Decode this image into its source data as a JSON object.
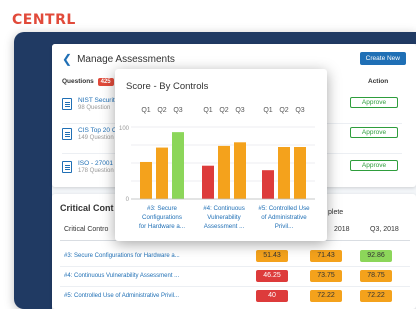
{
  "brand": "CENTRL",
  "assessments": {
    "title": "Manage Assessments",
    "create_button": "Create New",
    "questions_label": "Questions",
    "questions_count": "425",
    "d_label": "D",
    "action_label": "Action",
    "rows": [
      {
        "title": "NIST Security",
        "sub": "98 Question",
        "action": "Approve"
      },
      {
        "title": "CIS Top 20 C",
        "sub": "149 Question",
        "action": "Approve"
      },
      {
        "title": "ISO - 27001 -",
        "sub": "178 Question",
        "action": "Approve"
      }
    ]
  },
  "critical": {
    "title": "Critical Cont",
    "complete_label": "plete",
    "col_name": "Critical Contro",
    "col_2018": "2018",
    "col_q3": "Q3, 2018",
    "rows": [
      {
        "name": "#3: Secure Configurations for Hardware a...",
        "v1": "51.43",
        "v2": "71.43",
        "v3": "92.86",
        "c1": "orange",
        "c2": "orange",
        "c3": "green"
      },
      {
        "name": "#4: Continuous Vulnerability Assessment ...",
        "v1": "46.25",
        "v2": "73.75",
        "v3": "78.75",
        "c1": "red",
        "c2": "orange",
        "c3": "orange"
      },
      {
        "name": "#5: Controlled Use of Administrative Privil...",
        "v1": "40",
        "v2": "72.22",
        "v3": "72.22",
        "c1": "red",
        "c2": "orange",
        "c3": "orange"
      }
    ]
  },
  "popup": {
    "title": "Score - By Controls"
  },
  "chart_data": {
    "type": "bar",
    "title": "Score - By Controls",
    "ylim": [
      0,
      100
    ],
    "y_ticks": [
      "100",
      "0"
    ],
    "groups": [
      {
        "label_lines": [
          "#3: Secure",
          "Configurations",
          "for Hardware a..."
        ],
        "quarters": [
          "Q1",
          "Q2",
          "Q3"
        ],
        "values": [
          51.43,
          71.43,
          92.86
        ],
        "colors": [
          "#f4a21c",
          "#f4a21c",
          "#8cd65a"
        ]
      },
      {
        "label_lines": [
          "#4: Continuous",
          "Vulnerability",
          "Assessment ..."
        ],
        "quarters": [
          "Q1",
          "Q2",
          "Q3"
        ],
        "values": [
          46.25,
          73.75,
          78.75
        ],
        "colors": [
          "#dd3b3b",
          "#f4a21c",
          "#f4a21c"
        ]
      },
      {
        "label_lines": [
          "#5: Controlled Use",
          "of Administrative",
          "Privil..."
        ],
        "quarters": [
          "Q1",
          "Q2",
          "Q3"
        ],
        "values": [
          40,
          72.22,
          72.22
        ],
        "colors": [
          "#dd3b3b",
          "#f4a21c",
          "#f4a21c"
        ]
      }
    ],
    "grid": true,
    "legend": "none"
  }
}
